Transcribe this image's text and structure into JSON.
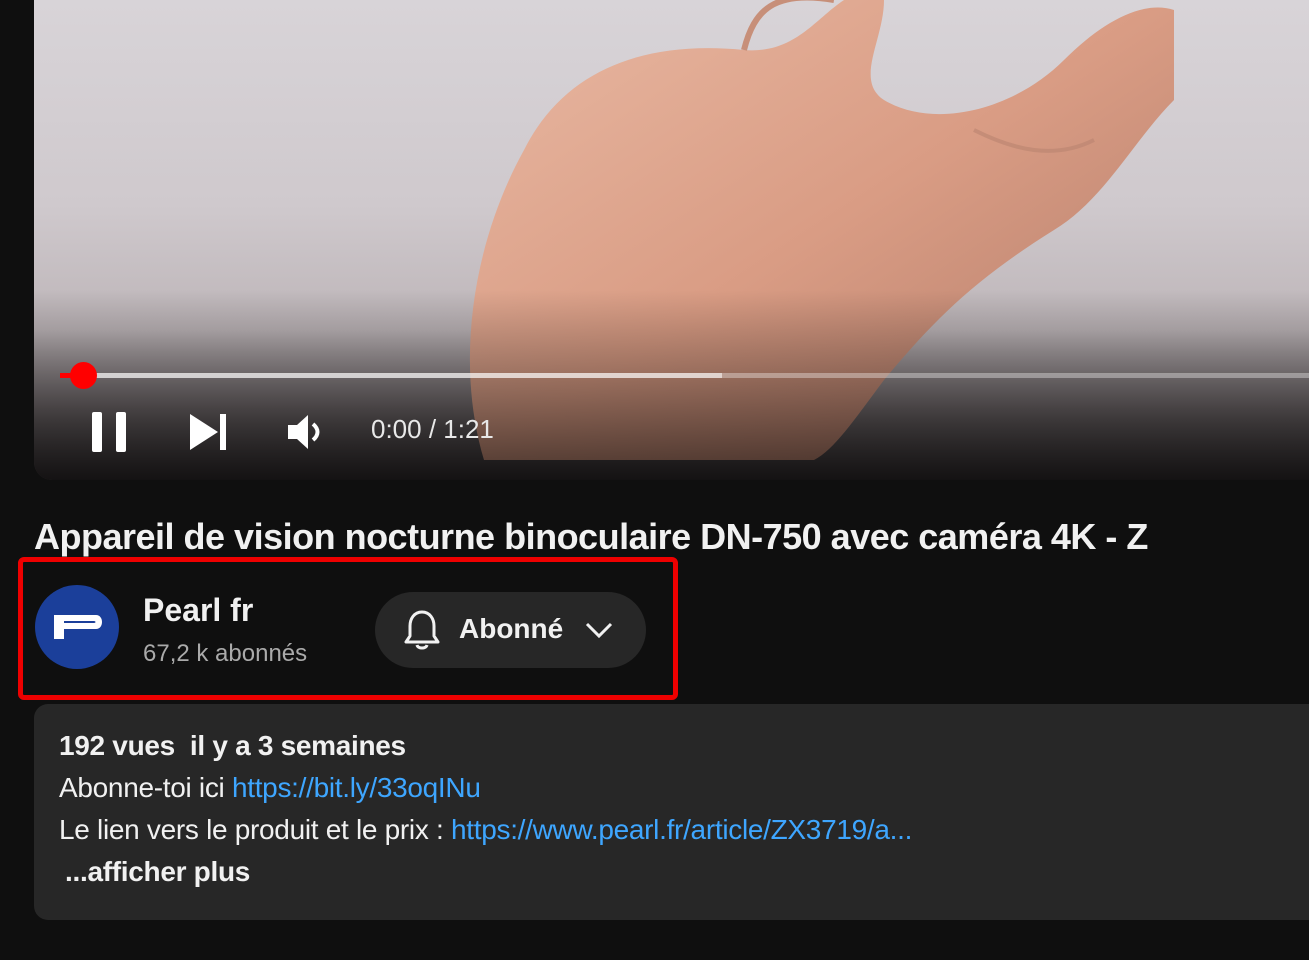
{
  "player": {
    "time_display": "0:00 / 1:21",
    "progress_fraction": 0.0,
    "buffered_fraction": 0.52
  },
  "video": {
    "title": "Appareil de vision nocturne binoculaire DN-750 avec caméra 4K - Z"
  },
  "channel": {
    "name": "Pearl fr",
    "subscribers": "67,2 k abonnés",
    "subscribe_label": "Abonné",
    "avatar_color": "#1b3f9a"
  },
  "description": {
    "views": "192 vues",
    "age": "il y a 3 semaines",
    "line2_text": "Abonne-toi ici",
    "line2_link": "https://bit.ly/33oqINu",
    "line3_text": "Le lien vers le produit et le prix :",
    "line3_link": "https://www.pearl.fr/article/ZX3719/a...",
    "more_label": "...afficher plus"
  },
  "colors": {
    "accent": "#ff0000",
    "link": "#3ea6ff",
    "highlight": "#ee0000"
  },
  "icons": [
    "pause-icon",
    "next-icon",
    "volume-icon",
    "bell-icon",
    "chevron-down-icon"
  ]
}
